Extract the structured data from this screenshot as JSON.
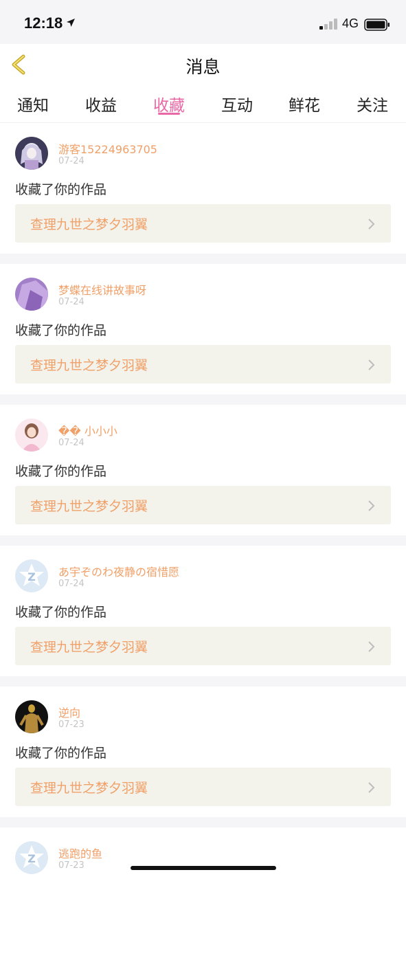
{
  "status_bar": {
    "time": "12:18",
    "network": "4G"
  },
  "nav": {
    "title": "消息"
  },
  "tabs": [
    {
      "label": "通知"
    },
    {
      "label": "收益"
    },
    {
      "label": "收藏",
      "active": true
    },
    {
      "label": "互动"
    },
    {
      "label": "鲜花"
    },
    {
      "label": "关注"
    }
  ],
  "items": [
    {
      "name": "游客15224963705",
      "date": "07-24",
      "action": "收藏了你的作品",
      "work": "查理九世之梦夕羽翼",
      "avatar": "anime-girl-avatar"
    },
    {
      "name": "梦蝶在线讲故事呀",
      "date": "07-24",
      "action": "收藏了你的作品",
      "work": "查理九世之梦夕羽翼",
      "avatar": "purple-avatar"
    },
    {
      "name": "�� 小小小",
      "date": "07-24",
      "action": "收藏了你的作品",
      "work": "查理九世之梦夕羽翼",
      "avatar": "pink-doll-avatar"
    },
    {
      "name": "あ宇ぞのわ夜静の宿惜愿",
      "date": "07-24",
      "action": "收藏了你的作品",
      "work": "查理九世之梦夕羽翼",
      "avatar": "default-z-avatar"
    },
    {
      "name": "逆向",
      "date": "07-23",
      "action": "收藏了你的作品",
      "work": "查理九世之梦夕羽翼",
      "avatar": "figure-avatar"
    },
    {
      "name": "逃跑的鱼",
      "date": "07-23",
      "action": "",
      "work": "",
      "avatar": "default-z-avatar"
    }
  ],
  "colors": {
    "accent": "#e869a5",
    "orange": "#f0a068",
    "back_arrow": "#c9a72a"
  }
}
